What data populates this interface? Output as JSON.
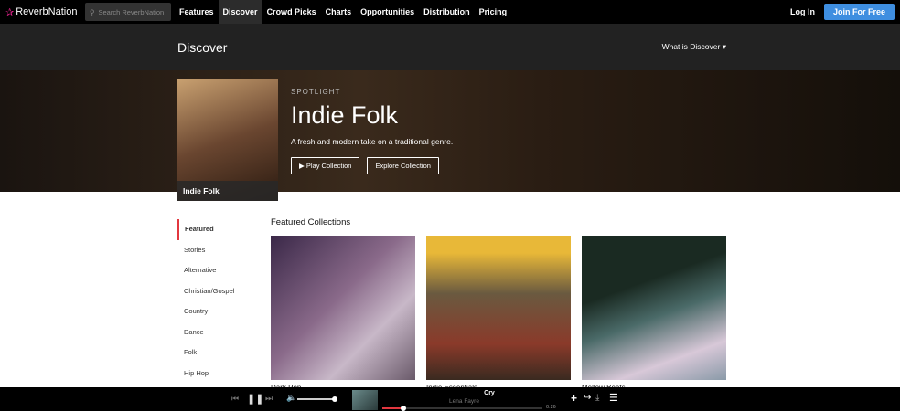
{
  "nav": {
    "brand": "ReverbNation",
    "search_placeholder": "Search ReverbNation",
    "items": [
      "Features",
      "Discover",
      "Crowd Picks",
      "Charts",
      "Opportunities",
      "Distribution",
      "Pricing"
    ],
    "login": "Log In",
    "join": "Join For Free"
  },
  "subheader": {
    "title": "Discover",
    "what": "What is Discover"
  },
  "hero": {
    "cover_label": "Indie Folk",
    "eyebrow": "SPOTLIGHT",
    "title": "Indie Folk",
    "description": "A fresh and modern take on a traditional genre.",
    "play": "Play Collection",
    "explore": "Explore Collection"
  },
  "sidebar": [
    "Featured",
    "Stories",
    "Alternative",
    "Christian/Gospel",
    "Country",
    "Dance",
    "Folk",
    "Hip Hop"
  ],
  "featured": {
    "heading": "Featured Collections",
    "cards": [
      "Dark Pop",
      "Indie Essentials",
      "Mellow Beats"
    ]
  },
  "player": {
    "title": "Cry",
    "artist": "Lena Fayre",
    "time": "0:26",
    "progress": 0.13,
    "volume": 0.9
  },
  "colors": {
    "accent": "#e2373f",
    "join": "#3e8ee0"
  }
}
